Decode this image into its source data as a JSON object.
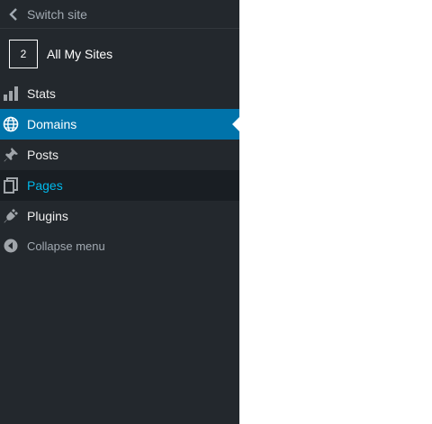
{
  "sidebar": {
    "switch_site": "Switch site",
    "all_sites": {
      "count": "2",
      "label": "All My Sites"
    },
    "items": [
      {
        "label": "Stats",
        "icon": "stats-icon"
      },
      {
        "label": "Domains",
        "icon": "globe-icon",
        "state": "current"
      },
      {
        "label": "Posts",
        "icon": "pushpin-icon"
      },
      {
        "label": "Pages",
        "icon": "pages-icon",
        "state": "hover"
      },
      {
        "label": "Plugins",
        "icon": "plug-icon"
      }
    ],
    "collapse": "Collapse menu"
  },
  "colors": {
    "sidebar_bg": "#23282d",
    "current_bg": "#0073aa",
    "hover_bg": "#191e23",
    "hover_text": "#00b9eb",
    "muted_text": "#a2aab2"
  }
}
